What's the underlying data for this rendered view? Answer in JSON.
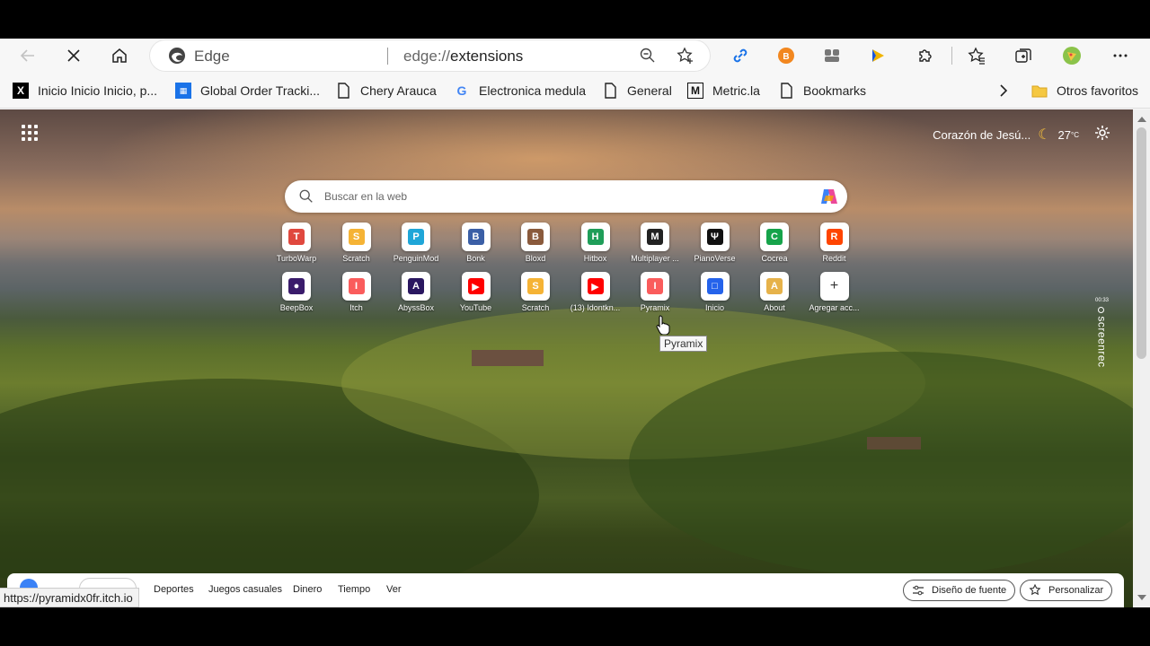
{
  "toolbar": {
    "edge_label": "Edge",
    "url_scheme": "edge://",
    "url_path": "extensions"
  },
  "bookmarks": [
    {
      "label": "Inicio Inicio Inicio, p...",
      "icon": "x-logo-icon"
    },
    {
      "label": "Global Order Tracki...",
      "icon": "sheet-icon"
    },
    {
      "label": "Chery Arauca",
      "icon": "page-icon"
    },
    {
      "label": "Electronica medula",
      "icon": "google-icon"
    },
    {
      "label": "General",
      "icon": "page-icon"
    },
    {
      "label": "Metric.la",
      "icon": "m-logo-icon"
    },
    {
      "label": "Bookmarks",
      "icon": "page-icon"
    }
  ],
  "other_favorites": "Otros favoritos",
  "weather": {
    "location": "Corazón de Jesú...",
    "temp": "27",
    "unit": "°C"
  },
  "search": {
    "placeholder": "Buscar en la web"
  },
  "quick_links_row1": [
    {
      "label": "TurboWarp",
      "color": "#e0483e",
      "glyph": "T"
    },
    {
      "label": "Scratch",
      "color": "#f5b335",
      "glyph": "S"
    },
    {
      "label": "PenguinMod",
      "color": "#1fa6d8",
      "glyph": "P"
    },
    {
      "label": "Bonk",
      "color": "#3b5fa6",
      "glyph": "B"
    },
    {
      "label": "Bloxd",
      "color": "#8a5a3c",
      "glyph": "B"
    },
    {
      "label": "Hitbox",
      "color": "#1f9e59",
      "glyph": "H"
    },
    {
      "label": "Multiplayer ...",
      "color": "#222222",
      "glyph": "M"
    },
    {
      "label": "PianoVerse",
      "color": "#111111",
      "glyph": "Ψ"
    },
    {
      "label": "Cocrea",
      "color": "#16a34a",
      "glyph": "C"
    },
    {
      "label": "Reddit",
      "color": "#ff4500",
      "glyph": "R"
    }
  ],
  "quick_links_row2": [
    {
      "label": "BeepBox",
      "color": "#3a1b6b",
      "glyph": "●"
    },
    {
      "label": "Itch",
      "color": "#fa5c5c",
      "glyph": "I"
    },
    {
      "label": "AbyssBox",
      "color": "#2a1760",
      "glyph": "A"
    },
    {
      "label": "YouTube",
      "color": "#ff0000",
      "glyph": "▶"
    },
    {
      "label": "Scratch",
      "color": "#f5b335",
      "glyph": "S"
    },
    {
      "label": "(13) Idontkn...",
      "color": "#ff0000",
      "glyph": "▶"
    },
    {
      "label": "Pyramix",
      "color": "#fa5c5c",
      "glyph": "I"
    },
    {
      "label": "Inicio",
      "color": "#2563eb",
      "glyph": "□"
    },
    {
      "label": "About",
      "color": "#e6b24a",
      "glyph": "A"
    },
    {
      "label": "Agregar acc...",
      "color": "#ffffff",
      "glyph": "+"
    }
  ],
  "tooltip": "Pyramix",
  "screenrec": {
    "time": "00:33",
    "label": "screenrec"
  },
  "feed": {
    "items": [
      "Deportes",
      "Juegos casuales",
      "Dinero",
      "Tiempo",
      "Ver"
    ],
    "font_design": "Diseño de fuente",
    "personalize": "Personalizar"
  },
  "status_url": "https://pyramidx0fr.itch.io"
}
